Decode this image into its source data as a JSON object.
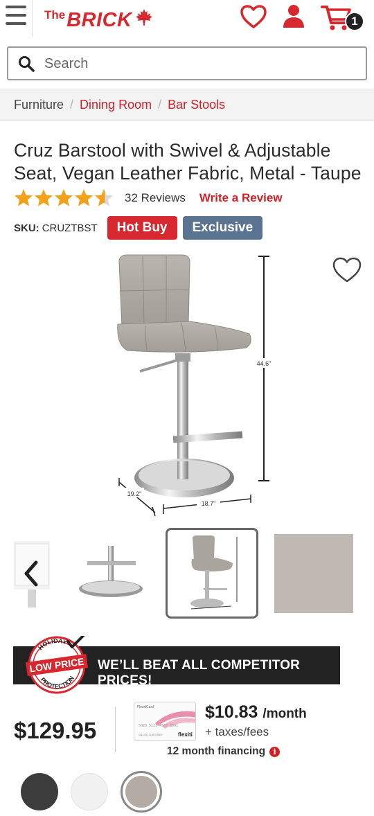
{
  "header": {
    "logo_the": "The",
    "logo_brick": "BRICK",
    "cart_count": "1",
    "brand_color": "#d8282f",
    "icons": [
      "menu-icon",
      "maple-leaf-icon",
      "heart-icon",
      "account-icon",
      "cart-icon"
    ]
  },
  "search": {
    "placeholder": "Search"
  },
  "breadcrumb": {
    "items": [
      "Furniture",
      "Dining Room",
      "Bar Stools"
    ],
    "separator": "/"
  },
  "product": {
    "title": "Cruz Barstool with Swivel & Adjustable Seat, Vegan Leather Fabric, Metal - Taupe",
    "rating": 4.5,
    "reviews_label": "32 Reviews",
    "write_review_label": "Write a Review",
    "sku_label": "SKU:",
    "sku_value": "CRUZTBST",
    "badges": {
      "hot_buy": "Hot Buy",
      "exclusive": "Exclusive"
    },
    "dimensions": {
      "height": "44.6\"",
      "depth": "19.2\"",
      "width": "18.7\""
    }
  },
  "gallery": {
    "thumbnail_count": 4,
    "selected_index": 2
  },
  "promo": {
    "seal_top": "HOLIDAY",
    "seal_main": "LOW PRICE",
    "seal_bottom": "PROTECTION",
    "banner_text": "WE’LL BEAT ALL COMPETITOR PRICES!"
  },
  "pricing": {
    "price": "$129.95",
    "monthly": "$10.83",
    "per_month": "/month",
    "taxes": "+ taxes/fees",
    "financing": "12 month financing",
    "card_label": "FlexitiCard",
    "card_number": "5028 5123 4567 8901",
    "card_brand": "flexiti",
    "card_holder": "VALUED CUSTOMER"
  },
  "swatches": [
    {
      "name": "Black",
      "color": "#3c3c3c"
    },
    {
      "name": "White",
      "color": "#f1f1f1"
    },
    {
      "name": "Taupe",
      "color": "#b4aba4",
      "selected": true
    }
  ]
}
